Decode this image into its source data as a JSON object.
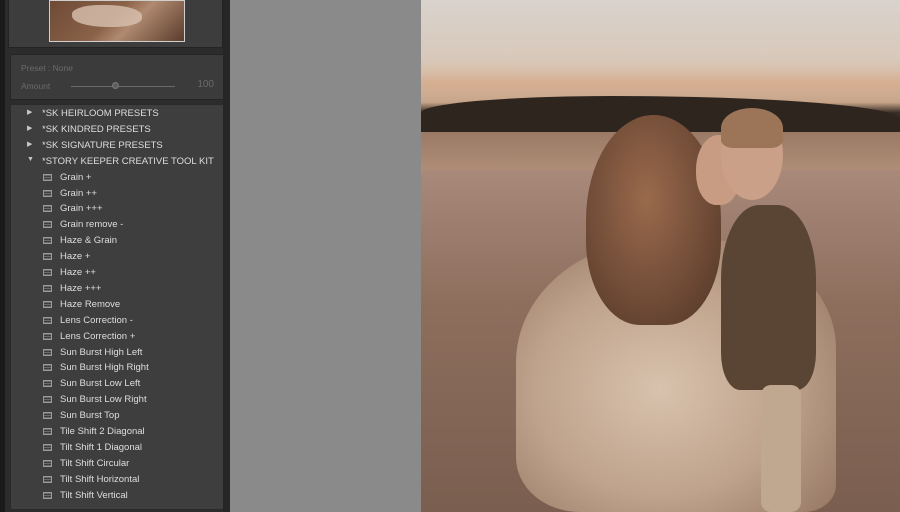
{
  "presets_panel": {
    "preset_label": "Preset : None",
    "amount_label": "Amount",
    "amount_value": "100",
    "amount_fraction": 0.5,
    "folders": [
      {
        "label": "*SK HEIRLOOM PRESETS",
        "expanded": false
      },
      {
        "label": "*SK KINDRED PRESETS",
        "expanded": false
      },
      {
        "label": "*SK SIGNATURE PRESETS",
        "expanded": false
      },
      {
        "label": "*STORY KEEPER CREATIVE TOOL KIT",
        "expanded": true
      }
    ],
    "presets": [
      "Grain +",
      "Grain ++",
      "Grain +++",
      "Grain remove -",
      "Haze & Grain",
      "Haze +",
      "Haze ++",
      "Haze +++",
      "Haze Remove",
      "Lens Correction -",
      "Lens Correction +",
      "Sun Burst High Left",
      "Sun Burst High Right",
      "Sun Burst Low Left",
      "Sun Burst Low Right",
      "Sun Burst Top",
      "Tile Shift 2 Diagonal",
      "Tilt Shift 1 Diagonal",
      "Tilt Shift Circular",
      "Tilt Shift Horizontal",
      "Tilt Shift Vertical"
    ]
  },
  "icons": {
    "collapsed": "triangle-right-icon",
    "expanded": "triangle-down-icon",
    "preset": "preset-file-icon"
  }
}
